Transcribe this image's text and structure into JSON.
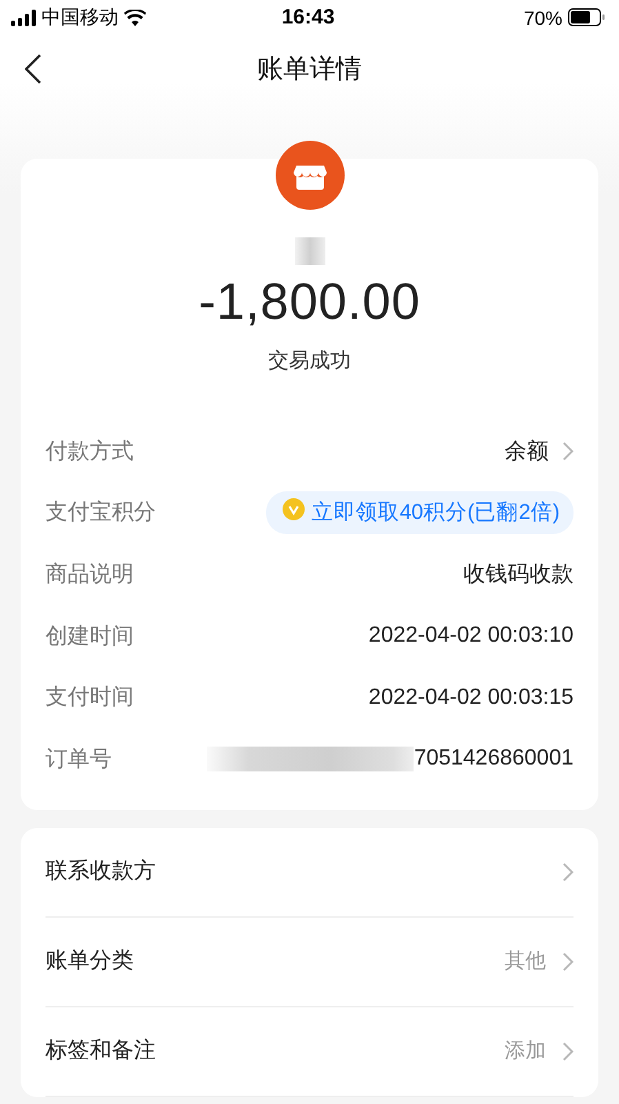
{
  "status_bar": {
    "carrier": "中国移动",
    "time": "16:43",
    "battery": "70%"
  },
  "nav": {
    "title": "账单详情"
  },
  "summary": {
    "amount": "-1,800.00",
    "status": "交易成功"
  },
  "details": [
    {
      "kind": "link",
      "label": "付款方式",
      "value": "余额"
    },
    {
      "kind": "badge",
      "label": "支付宝积分",
      "value": "立即领取40积分(已翻2倍)"
    },
    {
      "kind": "plain",
      "label": "商品说明",
      "value": "收钱码收款"
    },
    {
      "kind": "plain",
      "label": "创建时间",
      "value": "2022-04-02 00:03:10"
    },
    {
      "kind": "plain",
      "label": "支付时间",
      "value": "2022-04-02 00:03:15"
    },
    {
      "kind": "masked",
      "label": "订单号",
      "value": "7051426860001"
    }
  ],
  "actions": [
    {
      "label": "联系收款方"
    },
    {
      "label": "账单分类",
      "value": "其他"
    },
    {
      "label": "标签和备注",
      "value": "添加"
    }
  ]
}
